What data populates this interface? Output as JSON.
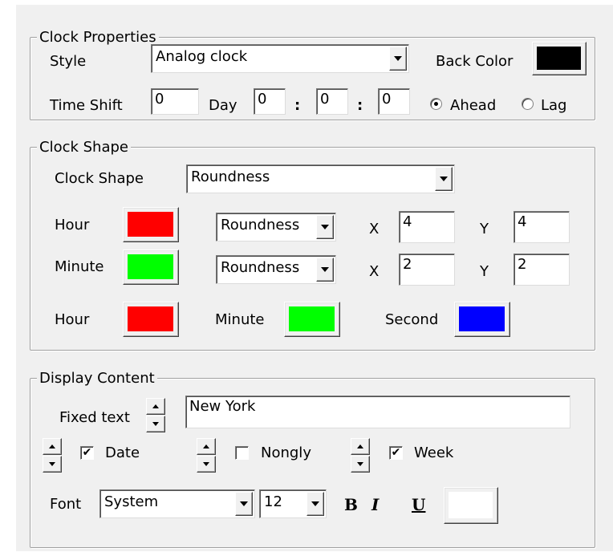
{
  "clock_properties": {
    "legend": "Clock Properties",
    "style_label": "Style",
    "style_value": "Analog clock",
    "back_color_label": "Back Color",
    "back_color": "#000000",
    "time_shift_label": "Time Shift",
    "time_shift_value": "0",
    "day_label": "Day",
    "day_value": "0",
    "colon1": ":",
    "minutes_value": "0",
    "colon2": ":",
    "seconds_value": "0",
    "ahead_label": "Ahead",
    "lag_label": "Lag",
    "selected_direction": "Ahead"
  },
  "clock_shape": {
    "legend": "Clock Shape",
    "shape_label": "Clock Shape",
    "shape_value": "Roundness",
    "hour_label": "Hour",
    "hour_color": "#ff0000",
    "hour_shape": "Roundness",
    "hour_x_label": "X",
    "hour_x": "4",
    "hour_y_label": "Y",
    "hour_y": "4",
    "minute_label": "Minute",
    "minute_color": "#00ff00",
    "minute_shape": "Roundness",
    "minute_x_label": "X",
    "minute_x": "2",
    "minute_y_label": "Y",
    "minute_y": "2",
    "hand_hour_label": "Hour",
    "hand_hour_color": "#ff0000",
    "hand_minute_label": "Minute",
    "hand_minute_color": "#00ff00",
    "hand_second_label": "Second",
    "hand_second_color": "#0000ff"
  },
  "display_content": {
    "legend": "Display Content",
    "fixed_text_label": "Fixed text",
    "fixed_text_value": "New York",
    "date_label": "Date",
    "date_checked": true,
    "nongly_label": "Nongly",
    "nongly_checked": false,
    "week_label": "Week",
    "week_checked": true,
    "font_label": "Font",
    "font_value": "System",
    "font_size": "12",
    "bold_label": "B",
    "italic_label": "I",
    "underline_label": "U",
    "font_color": "#ffffff"
  }
}
